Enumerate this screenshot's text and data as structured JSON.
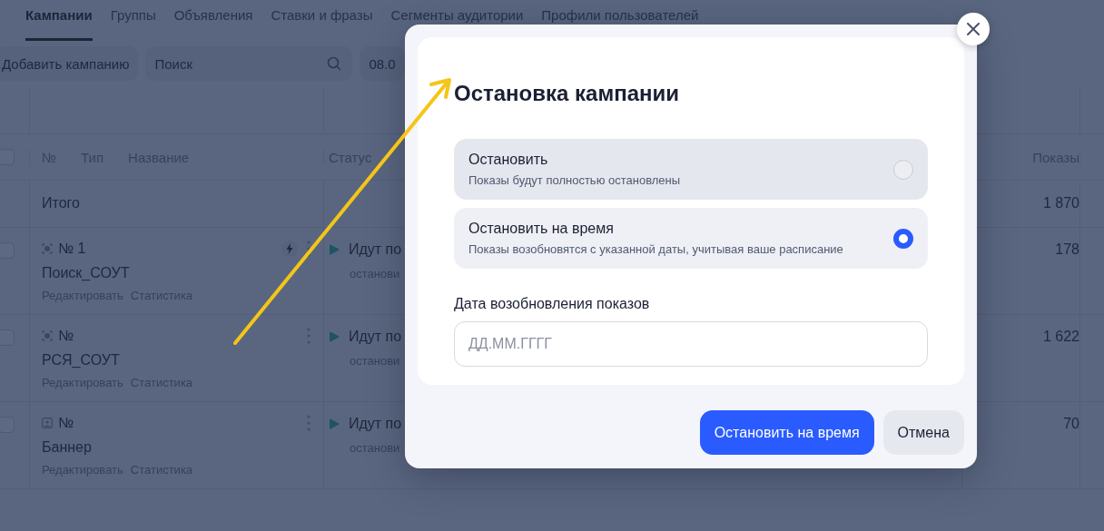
{
  "tabs": [
    {
      "label": "Кампании",
      "selected": true
    },
    {
      "label": "Группы",
      "selected": false
    },
    {
      "label": "Объявления",
      "selected": false
    },
    {
      "label": "Ставки и фразы",
      "selected": false
    },
    {
      "label": "Сегменты аудитории",
      "selected": false
    },
    {
      "label": "Профили пользователей",
      "selected": false
    }
  ],
  "toolbar": {
    "add_button": "Добавить кампанию",
    "search": {
      "placeholder": "Поиск"
    },
    "date": "08.0"
  },
  "table": {
    "header_checked": false,
    "columns": [
      "№",
      "Тип",
      "Название",
      "Статус",
      "Показы"
    ],
    "total": {
      "label": "Итого",
      "impressions": "1 870"
    },
    "rows": [
      {
        "checked": false,
        "kind": "search",
        "number": "№ 1",
        "name": "Поиск_СОУТ",
        "links": [
          "Редактировать",
          "Статистика"
        ],
        "lightning": true,
        "status": "Идут по",
        "substatus": "останови",
        "impressions": "178"
      },
      {
        "checked": false,
        "kind": "search",
        "number": "№",
        "name": "РСЯ_СОУТ",
        "links": [
          "Редактировать",
          "Статистика"
        ],
        "lightning": false,
        "status": "Идут по",
        "substatus": "останови",
        "impressions": "1 622"
      },
      {
        "checked": false,
        "kind": "banner",
        "number": "№",
        "name": "Баннер",
        "links": [
          "Редактировать",
          "Статистика"
        ],
        "lightning": false,
        "status": "Идут по",
        "substatus": "останови",
        "impressions": "70"
      }
    ]
  },
  "dialog": {
    "title": "Остановка кампании",
    "options": [
      {
        "label": "Остановить",
        "hint": "Показы будут полностью остановлены",
        "selected": false
      },
      {
        "label": "Остановить на время",
        "hint": "Показы возобновятся с указанной даты, учитывая ваше расписание",
        "selected": true
      }
    ],
    "date_label": "Дата возобновления показов",
    "date_field": {
      "placeholder": "ДД.ММ.ГГГГ"
    },
    "buttons": [
      {
        "label": "Остановить на время",
        "kind": "primary"
      },
      {
        "label": "Отмена",
        "kind": "secondary"
      }
    ]
  }
}
